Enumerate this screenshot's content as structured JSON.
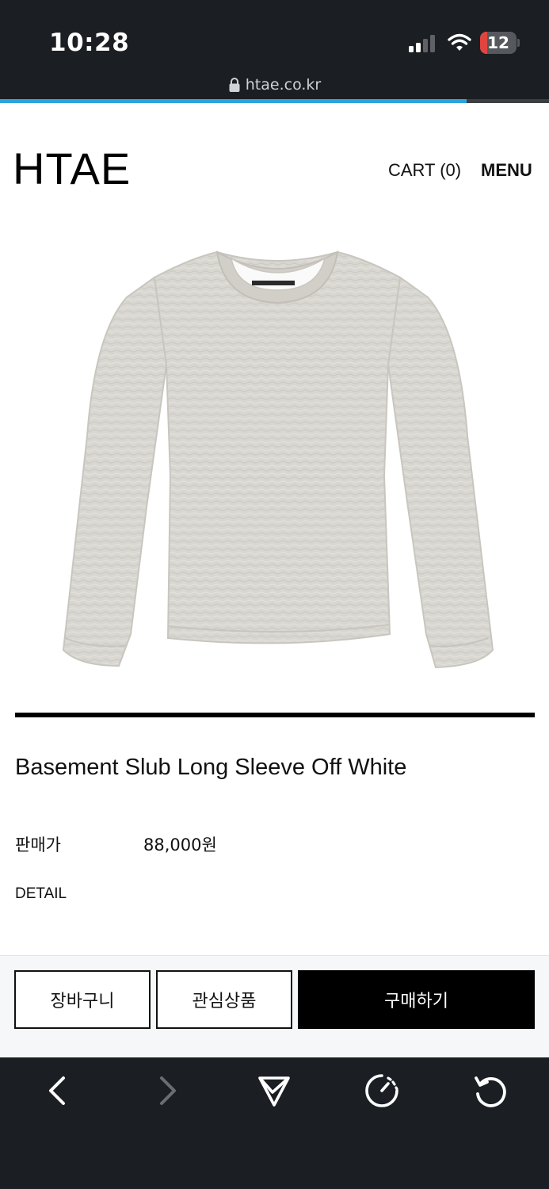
{
  "status_bar": {
    "time": "10:28",
    "battery_level": "12"
  },
  "browser": {
    "url": "htae.co.kr",
    "load_progress": 0.85
  },
  "header": {
    "logo": "HTAE",
    "cart_label": "CART (0)",
    "menu_label": "MENU"
  },
  "product": {
    "image_icon": "long-sleeve-shirt-photo",
    "title": "Basement Slub Long Sleeve Off White",
    "price_label": "판매가",
    "price_value": "88,000원",
    "detail_label": "DETAIL"
  },
  "actions": {
    "cart_button": "장바구니",
    "wishlist_button": "관심상품",
    "buy_button": "구매하기"
  },
  "toolbar": {
    "icons": [
      "back-icon",
      "forward-icon",
      "share-icon",
      "speed-dial-icon",
      "reload-icon"
    ]
  },
  "colors": {
    "accent": "#2aa3e0",
    "chrome_bg": "#1b1e22",
    "buy_button_bg": "#000000"
  }
}
